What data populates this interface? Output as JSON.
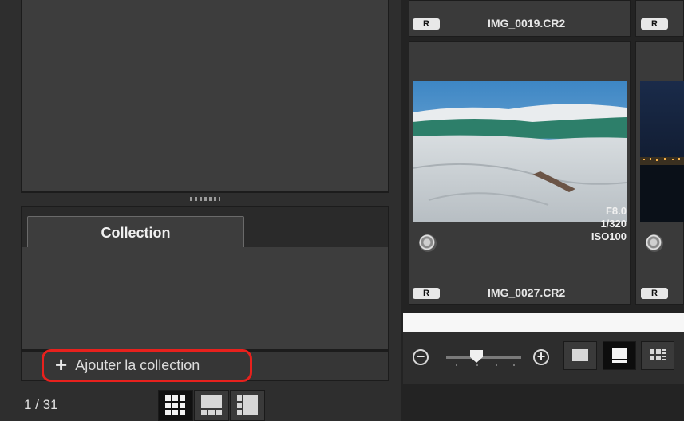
{
  "left_panel": {
    "collection_tab_label": "Collection",
    "add_collection_label": "Ajouter la collection",
    "add_collection_icon": "plus-icon",
    "image_count": "1 / 31",
    "view_modes": [
      "grid-view-icon",
      "filmstrip-view-icon",
      "split-view-icon"
    ]
  },
  "thumbnails": [
    {
      "badge": "R",
      "filename": "IMG_0019.CR2"
    },
    {
      "badge": "R",
      "filename": ""
    },
    {
      "badge": "R",
      "filename": "IMG_0027.CR2",
      "aperture": "F8.0",
      "shutter": "1/320",
      "iso": "ISO100"
    },
    {
      "badge": "R",
      "filename": ""
    }
  ],
  "zoom": {
    "zoom_out_icon": "minus-circle-icon",
    "zoom_in_icon": "plus-circle-icon",
    "slider_level": 0.35,
    "thumbnail_size_modes": [
      "small-thumbnail-icon",
      "medium-thumbnail-icon",
      "details-thumbnail-icon"
    ],
    "selected_size": "medium"
  },
  "colors": {
    "highlight": "#e8211d",
    "panel": "#3d3d3d",
    "background": "#232323"
  }
}
